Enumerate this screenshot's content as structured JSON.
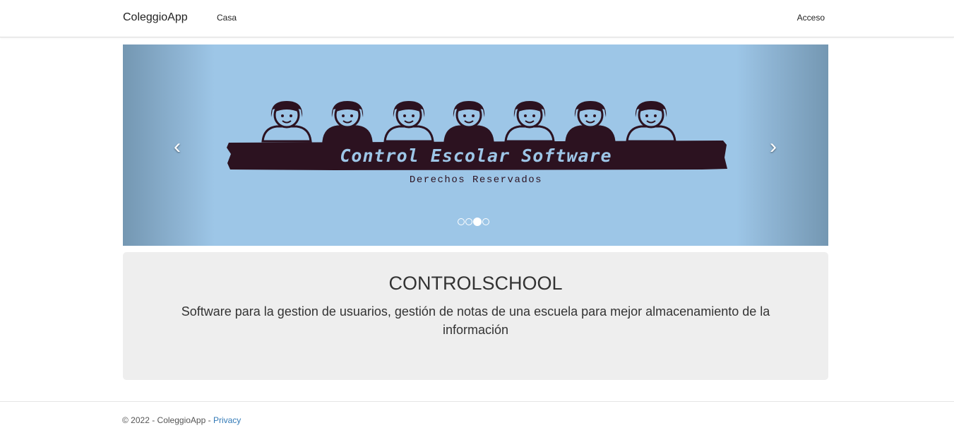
{
  "navbar": {
    "brand": "ColeggioApp",
    "home": "Casa",
    "login": "Acceso"
  },
  "carousel": {
    "banner_title": "Control Escolar Software",
    "banner_subtitle": "Derechos Reservados",
    "prev_glyph": "‹",
    "next_glyph": "›",
    "slide_count": 4,
    "active_index": 2
  },
  "hero": {
    "title": "CONTROLSCHOOL",
    "description": "Software para la gestion de usuarios, gestión de notas de una escuela para mejor almacenamiento de la información"
  },
  "footer": {
    "copyright": "© 2022 - ColeggioApp -",
    "privacy": "Privacy"
  },
  "colors": {
    "banner_bg": "#9dc6e7",
    "banner_dark": "#2c1220",
    "jumbotron_bg": "#eeeeee",
    "link": "#337ab7"
  }
}
